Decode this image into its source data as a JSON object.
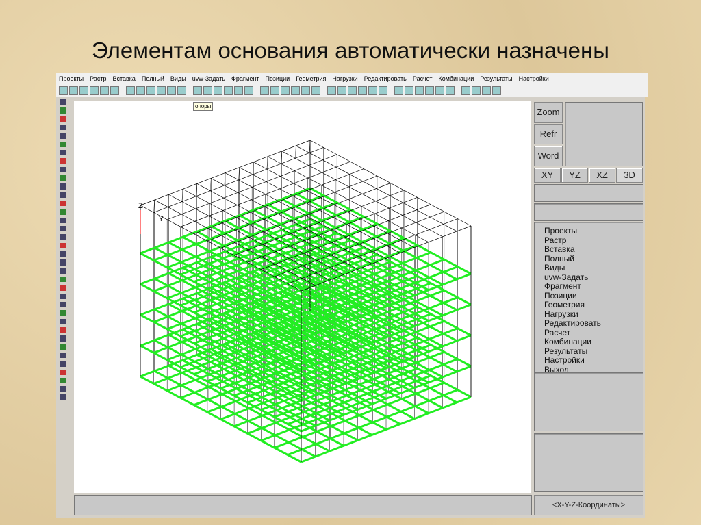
{
  "slide_title": "Элементам основания автоматически назначены",
  "menu": [
    "Проекты",
    "Растр",
    "Вставка",
    "Полный",
    "Виды",
    "uvw-Задать",
    "Фрагмент",
    "Позиции",
    "Геометрия",
    "Нагрузки",
    "Редактировать",
    "Расчет",
    "Комбинации",
    "Результаты",
    "Настройки"
  ],
  "tooltip": "опоры",
  "right_panel": {
    "zoom": "Zoom",
    "refr": "Refr",
    "word": "Word",
    "views": [
      "XY",
      "YZ",
      "XZ",
      "3D"
    ],
    "active_view": "3D",
    "list": [
      "Проекты",
      "Растр",
      "Вставка",
      "Полный",
      "Виды",
      "uvw-Задать",
      "Фрагмент",
      "Позиции",
      "Геометрия",
      "Нагрузки",
      "Редактировать",
      "Расчет",
      "Комбинации",
      "Результаты",
      "Настройки",
      "Выход"
    ],
    "coords": "<X-Y-Z-Координаты>"
  },
  "axes": {
    "z": "Z",
    "y": "Y"
  },
  "colors": {
    "slab": "#22ee22",
    "frame": "#000000"
  }
}
